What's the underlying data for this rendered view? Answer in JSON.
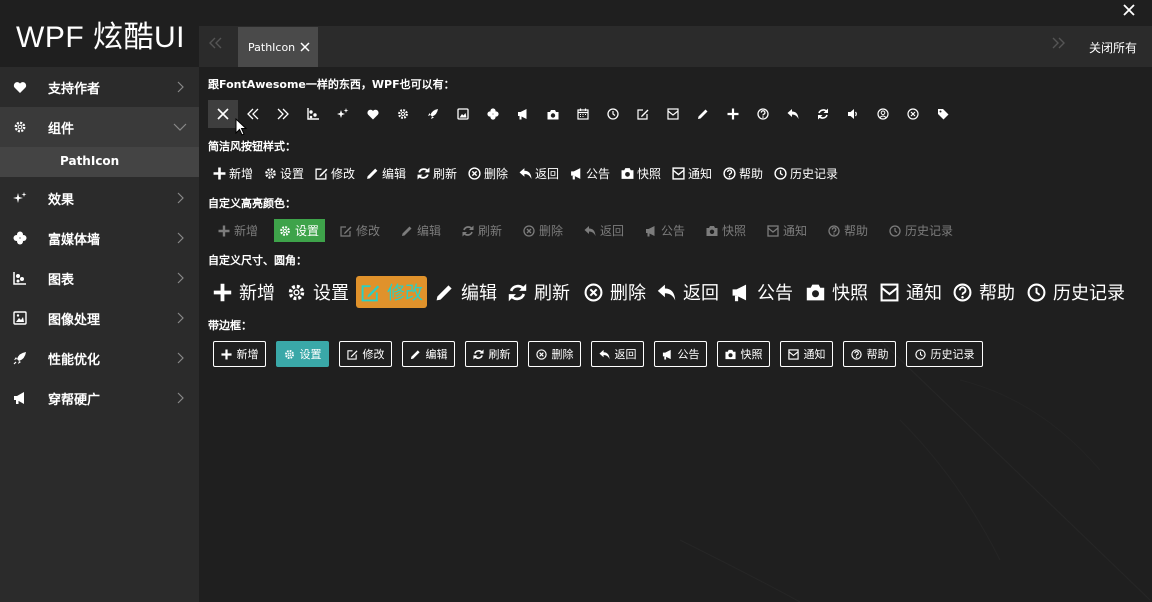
{
  "app": {
    "title": "WPF 炫酷UI"
  },
  "tabs": {
    "items": [
      {
        "label": "PathIcon"
      }
    ],
    "close_all": "关闭所有"
  },
  "sidebar": {
    "items": [
      {
        "label": "支持作者",
        "icon": "heart-icon"
      },
      {
        "label": "组件",
        "icon": "gear-icon",
        "expanded": true
      },
      {
        "label": "效果",
        "icon": "sparkle-icon"
      },
      {
        "label": "富媒体墙",
        "icon": "clover-icon"
      },
      {
        "label": "图表",
        "icon": "chart-icon"
      },
      {
        "label": "图像处理",
        "icon": "image-icon"
      },
      {
        "label": "性能优化",
        "icon": "rocket-icon"
      },
      {
        "label": "穿帮硬广",
        "icon": "megaphone-icon"
      }
    ],
    "sub_item": "PathIcon"
  },
  "content": {
    "intro": "跟FontAwesome一样的东西，WPF也可以有：",
    "icons": [
      "close-icon",
      "double-left-icon",
      "double-right-icon",
      "chart-icon",
      "sparkle-icon",
      "heart-icon",
      "gear-icon",
      "rocket-icon",
      "image-icon",
      "clover-icon",
      "megaphone-icon",
      "camera-icon",
      "calendar-icon",
      "clock-icon",
      "edit-icon",
      "envelope-icon",
      "pencil-icon",
      "plus-icon",
      "question-icon",
      "reply-icon",
      "refresh-icon",
      "volume-icon",
      "user-circle-icon",
      "times-circle-icon",
      "tag-icon"
    ],
    "sections": {
      "simple": "简洁风按钮样式：",
      "highlight": "自定义高亮颜色：",
      "size": "自定义尺寸、圆角：",
      "border": "带边框："
    },
    "buttons": [
      {
        "label": "新增",
        "icon": "plus-icon"
      },
      {
        "label": "设置",
        "icon": "gear-icon"
      },
      {
        "label": "修改",
        "icon": "edit-icon"
      },
      {
        "label": "编辑",
        "icon": "pencil-icon"
      },
      {
        "label": "刷新",
        "icon": "refresh-icon"
      },
      {
        "label": "删除",
        "icon": "times-circle-icon"
      },
      {
        "label": "返回",
        "icon": "reply-icon"
      },
      {
        "label": "公告",
        "icon": "megaphone-icon"
      },
      {
        "label": "快照",
        "icon": "camera-icon"
      },
      {
        "label": "通知",
        "icon": "envelope-icon"
      },
      {
        "label": "帮助",
        "icon": "question-icon"
      },
      {
        "label": "历史记录",
        "icon": "clock-icon"
      }
    ]
  },
  "colors": {
    "highlight_green": "#3ea34a",
    "highlight_orange": "#e0922b",
    "highlight_orange_text": "#2ad0c4",
    "highlight_teal": "#3aa8a8"
  }
}
